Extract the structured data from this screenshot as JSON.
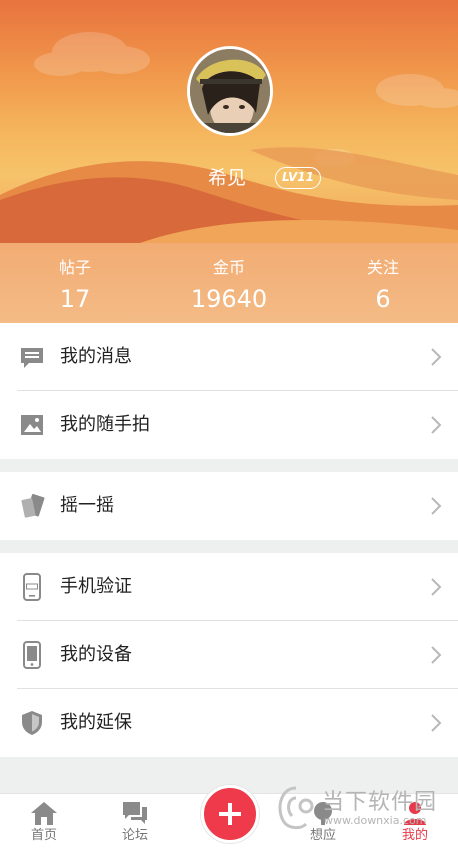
{
  "profile": {
    "username": "希见",
    "level": "LV11"
  },
  "stats": [
    {
      "label": "帖子",
      "value": "17"
    },
    {
      "label": "金币",
      "value": "19640"
    },
    {
      "label": "关注",
      "value": "6"
    }
  ],
  "menu": {
    "group1": [
      {
        "label": "我的消息",
        "icon": "message-icon"
      },
      {
        "label": "我的随手拍",
        "icon": "image-icon"
      }
    ],
    "group2": [
      {
        "label": "摇一摇",
        "icon": "shake-icon"
      }
    ],
    "group3": [
      {
        "label": "手机验证",
        "icon": "phone-verify-icon"
      },
      {
        "label": "我的设备",
        "icon": "device-icon"
      },
      {
        "label": "我的延保",
        "icon": "shield-icon"
      }
    ]
  },
  "tabbar": {
    "home": "首页",
    "forum": "论坛",
    "idea": "想应",
    "mine": "我的"
  },
  "watermark": {
    "title": "当下软件园",
    "url": "www.downxia.com"
  },
  "colors": {
    "accent": "#ee3a4a",
    "header_top": "#e8733e",
    "header_bottom": "#f6c36a"
  }
}
